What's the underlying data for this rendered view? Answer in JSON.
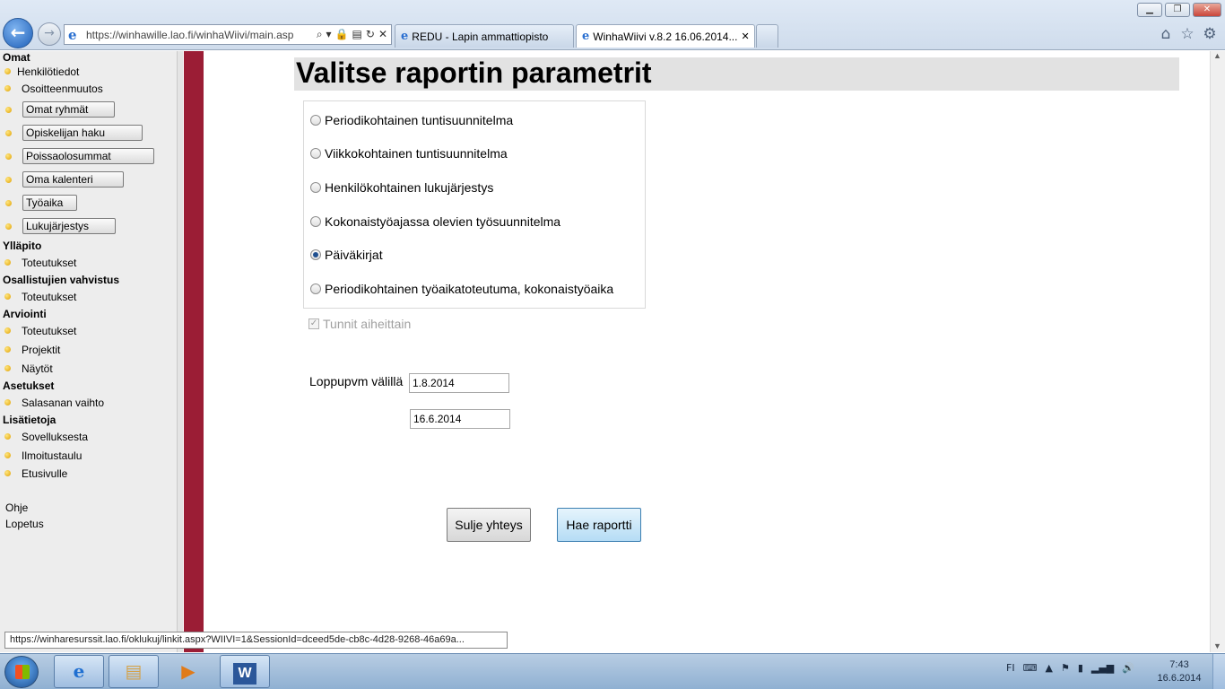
{
  "browser": {
    "window_controls": {
      "minimize": "▁",
      "maximize": "❐",
      "close": "✕"
    },
    "back_icon": "←",
    "forward_icon": "→",
    "address": {
      "url": "https://winhawille.lao.fi/winhaWiivi/main.asp",
      "icons": [
        "search-icon",
        "dropdown-icon",
        "lock-icon",
        "compat-icon",
        "refresh-icon",
        "stop-icon"
      ],
      "icon_glyphs": {
        "search": "⌕",
        "dropdown": "▾",
        "lock": "🔒",
        "compat": "▤",
        "refresh": "↻",
        "stop": "✕"
      }
    },
    "tabs": [
      {
        "label": "REDU - Lapin ammattiopisto"
      },
      {
        "label": "WinhaWiivi v.8.2 16.06.2014...",
        "close": "✕"
      }
    ],
    "toolbar_icons": {
      "home": "⌂",
      "favorites": "☆",
      "tools": "⚙"
    }
  },
  "sidebar": {
    "sections": {
      "omat": "Omat",
      "yllapito": "Ylläpito",
      "osallistujien": "Osallistujien vahvistus",
      "arviointi": "Arviointi",
      "asetukset": "Asetukset",
      "lisatietoja": "Lisätietoja"
    },
    "links": {
      "henkilotiedot": "Henkilötiedot",
      "osoitteenmuutos": "Osoitteenmuutos",
      "yllapito_toteutukset": "Toteutukset",
      "osallistujien_toteutukset": "Toteutukset",
      "arviointi_toteutukset": "Toteutukset",
      "projektit": "Projektit",
      "naytot": "Näytöt",
      "salasanan_vaihto": "Salasanan vaihto",
      "sovelluksesta": "Sovelluksesta",
      "ilmoitustaulu": "Ilmoitustaulu",
      "etusivulle": "Etusivulle",
      "ohje": "Ohje",
      "lopetus": "Lopetus"
    },
    "buttons": {
      "omat_ryhmat": "Omat ryhmät",
      "opiskelijan_haku": "Opiskelijan haku",
      "poissaolosummat": "Poissaolosummat",
      "oma_kalenteri": "Oma kalenteri",
      "tyoaika": "Työaika",
      "lukujarjestys": "Lukujärjestys"
    }
  },
  "main": {
    "title": "Valitse raportin parametrit",
    "report_options": [
      {
        "label": "Periodikohtainen tuntisuunnitelma",
        "checked": false
      },
      {
        "label": "Viikkokohtainen tuntisuunnitelma",
        "checked": false
      },
      {
        "label": "Henkilökohtainen lukujärjestys",
        "checked": false
      },
      {
        "label": "Kokonaistyöajassa olevien työsuunnitelma",
        "checked": false
      },
      {
        "label": "Päiväkirjat",
        "checked": true
      },
      {
        "label": "Periodikohtainen työaikatoteutuma, kokonaistyöaika",
        "checked": false
      }
    ],
    "topics_checkbox": {
      "label": "Tunnit aiheittain",
      "checked": true,
      "disabled": true,
      "mark": "✓"
    },
    "date_range": {
      "label": "Loppupvm välillä",
      "end_value": "1.8.2014",
      "start_value": "16.6.2014"
    },
    "buttons": {
      "close": "Sulje yhteys",
      "fetch": "Hae raportti"
    }
  },
  "status_tip": "https://winharesurssit.lao.fi/oklukuj/linkit.aspx?WIIVI=1&SessionId=dceed5de-cb8c-4d28-9268-46a69a...",
  "scrollbar": {
    "up": "▲",
    "down": "▼"
  },
  "taskbar": {
    "apps": [
      "start-orb",
      "internet-explorer",
      "windows-explorer",
      "media-player",
      "microsoft-word"
    ],
    "glyphs": {
      "ie": "e",
      "explorer": "▤",
      "media": "▶",
      "word": "W"
    },
    "tray": {
      "language": "FI",
      "keyboard": "⌨",
      "arrow": "▲",
      "flag": "⚑",
      "battery": "▮",
      "signal": "▂▄▆",
      "volume": "🔊"
    },
    "time": "7:43",
    "date": "16.6.2014"
  },
  "colors": {
    "accent_bar": "#9b1d35",
    "title_bar_bg": "#e2e2e2",
    "sidebar_bg": "#ededed",
    "fetch_button": "#b5dcf5",
    "taskbar": "#8fb0d2"
  }
}
